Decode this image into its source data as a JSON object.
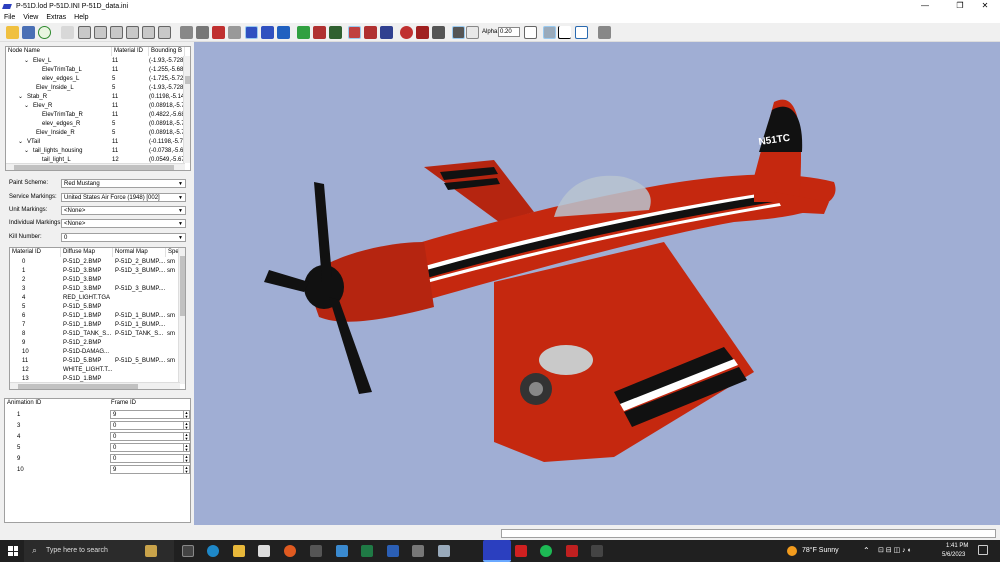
{
  "window": {
    "title": "P-51D.lod  P-51D.INI  P-51D_data.ini",
    "minimize": "—",
    "maximize": "❐",
    "close": "✕"
  },
  "menu": [
    "File",
    "View",
    "Extras",
    "Help"
  ],
  "toolbar": {
    "alpha_label": "Alpha:",
    "alpha_value": "0.20"
  },
  "node_tree": {
    "headers": [
      "Node Name",
      "Material ID",
      "Bounding B"
    ],
    "rows": [
      {
        "name": "Elev_L",
        "indent": 3,
        "exp": "⌄",
        "mat": "11",
        "bb": "(-1.93,-5.728"
      },
      {
        "name": "ElevTrimTab_L",
        "indent": 5,
        "exp": "",
        "mat": "11",
        "bb": "(-1.255,-5.68"
      },
      {
        "name": "elev_edges_L",
        "indent": 5,
        "exp": "",
        "mat": "5",
        "bb": "(-1.725,-5.72"
      },
      {
        "name": "Elev_Inside_L",
        "indent": 4,
        "exp": "",
        "mat": "5",
        "bb": "(-1.93,-5.728"
      },
      {
        "name": "Stab_R",
        "indent": 2,
        "exp": "⌄",
        "mat": "11",
        "bb": "(0.1198,-5.14"
      },
      {
        "name": "Elev_R",
        "indent": 3,
        "exp": "⌄",
        "mat": "11",
        "bb": "(0.08918,-5.7"
      },
      {
        "name": "ElevTrimTab_R",
        "indent": 5,
        "exp": "",
        "mat": "11",
        "bb": "(0.4822,-5.68"
      },
      {
        "name": "elev_edges_R",
        "indent": 5,
        "exp": "",
        "mat": "5",
        "bb": "(0.08918,-5.7"
      },
      {
        "name": "Elev_Inside_R",
        "indent": 4,
        "exp": "",
        "mat": "5",
        "bb": "(0.08918,-5.7"
      },
      {
        "name": "VTail",
        "indent": 2,
        "exp": "⌄",
        "mat": "11",
        "bb": "(-0.1198,-5.7"
      },
      {
        "name": "tail_lights_housing",
        "indent": 3,
        "exp": "⌄",
        "mat": "11",
        "bb": "(-0.0738,-5.6"
      },
      {
        "name": "tail_light_L",
        "indent": 5,
        "exp": "",
        "mat": "12",
        "bb": "(0.0549,-5.67"
      }
    ]
  },
  "properties": [
    {
      "label": "Paint Scheme:",
      "value": "Red Mustang"
    },
    {
      "label": "Service Markings:",
      "value": "United States Air Force (1948) [002]"
    },
    {
      "label": "Unit Markings:",
      "value": "<None>"
    },
    {
      "label": "Individual Markings:",
      "value": "<None>"
    },
    {
      "label": "Kill Number:",
      "value": "0"
    }
  ],
  "materials": {
    "headers": [
      "Material ID",
      "Diffuse Map",
      "Normal Map",
      "Spe"
    ],
    "rows": [
      [
        "0",
        "P-51D_2.BMP",
        "P-51D_2_BUMP....",
        "sm"
      ],
      [
        "1",
        "P-51D_3.BMP",
        "P-51D_3_BUMP....",
        "sm"
      ],
      [
        "2",
        "P-51D_3.BMP",
        "",
        ""
      ],
      [
        "3",
        "P-51D_3.BMP",
        "P-51D_3_BUMP....",
        ""
      ],
      [
        "4",
        "RED_LIGHT.TGA",
        "",
        ""
      ],
      [
        "5",
        "P-51D_5.BMP",
        "",
        ""
      ],
      [
        "6",
        "P-51D_1.BMP",
        "P-51D_1_BUMP....",
        "sm"
      ],
      [
        "7",
        "P-51D_1.BMP",
        "P-51D_1_BUMP....",
        ""
      ],
      [
        "8",
        "P-51D_TANK_S...",
        "P-51D_TANK_S...",
        "sm"
      ],
      [
        "9",
        "P-51D_2.BMP",
        "",
        ""
      ],
      [
        "10",
        "P-51D-DAMAG...",
        "",
        ""
      ],
      [
        "11",
        "P-51D_5.BMP",
        "P-51D_5_BUMP....",
        "sm"
      ],
      [
        "12",
        "WHITE_LIGHT.T...",
        "",
        ""
      ],
      [
        "13",
        "P-51D_1.BMP",
        "",
        ""
      ]
    ]
  },
  "animations": {
    "headers": [
      "Animation ID",
      "Frame ID"
    ],
    "rows": [
      [
        "1",
        "9"
      ],
      [
        "3",
        "0"
      ],
      [
        "4",
        "0"
      ],
      [
        "5",
        "0"
      ],
      [
        "9",
        "0"
      ],
      [
        "10",
        "9"
      ]
    ]
  },
  "aircraft": {
    "registration": "N51TC"
  },
  "taskbar": {
    "search_placeholder": "Type here to search",
    "weather": "78°F  Sunny",
    "time": "1:41 PM",
    "date": "5/6/2023"
  },
  "colors": {
    "viewport_bg": "#a0aed4",
    "fuselage_red": "#c5280f",
    "taskbar_bg": "#202020"
  }
}
